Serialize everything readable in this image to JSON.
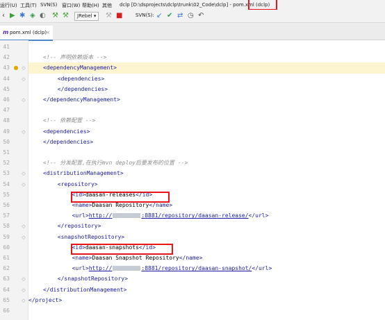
{
  "menubar": {
    "items": [
      "运行(U)",
      "工具(T)",
      "SVN(S)",
      "窗口(W)",
      "帮助(H)",
      "其他"
    ],
    "project_title": "dclp [D:\\dsprojects\\dclp\\trunk\\02_Code\\dclp] - pom.xml (dclp)"
  },
  "toolbar": {
    "jrebel_label": "JRebel ▾",
    "svn_label": "SVN(S):"
  },
  "tab": {
    "label": "pom.xml (dclp)",
    "close": "×"
  },
  "editor": {
    "lines": [
      {
        "number": "41",
        "indent": 0,
        "segments": []
      },
      {
        "number": "42",
        "indent": 2,
        "segments": [
          {
            "cls": "cmt",
            "text": "<!-- 声明依赖版本 -->"
          }
        ]
      },
      {
        "number": "43",
        "indent": 2,
        "highlight": true,
        "segments": [
          {
            "cls": "tag",
            "text": "<dependencyManagement>"
          }
        ]
      },
      {
        "number": "44",
        "indent": 6,
        "segments": [
          {
            "cls": "tag",
            "text": "<dependencies>"
          }
        ]
      },
      {
        "number": "45",
        "indent": 6,
        "segments": [
          {
            "cls": "tag",
            "text": "</dependencies>"
          }
        ]
      },
      {
        "number": "46",
        "indent": 2,
        "segments": [
          {
            "cls": "tag",
            "text": "</dependencyManagement>"
          }
        ]
      },
      {
        "number": "47",
        "indent": 0,
        "segments": []
      },
      {
        "number": "48",
        "indent": 2,
        "segments": [
          {
            "cls": "cmt",
            "text": "<!-- 依赖配置 -->"
          }
        ]
      },
      {
        "number": "49",
        "indent": 2,
        "segments": [
          {
            "cls": "tag",
            "text": "<dependencies>"
          }
        ]
      },
      {
        "number": "50",
        "indent": 2,
        "segments": [
          {
            "cls": "tag",
            "text": "</dependencies>"
          }
        ]
      },
      {
        "number": "51",
        "indent": 0,
        "segments": []
      },
      {
        "number": "52",
        "indent": 2,
        "segments": [
          {
            "cls": "cmt",
            "text": "<!-- 分发配置,在执行mvn deploy后要发布的位置 -->"
          }
        ]
      },
      {
        "number": "53",
        "indent": 2,
        "segments": [
          {
            "cls": "tag",
            "text": "<distributionManagement>"
          }
        ]
      },
      {
        "number": "54",
        "indent": 6,
        "segments": [
          {
            "cls": "tag",
            "text": "<repository>"
          }
        ]
      },
      {
        "number": "55",
        "indent": 10,
        "segments": [
          {
            "cls": "tag",
            "text": "<id>"
          },
          {
            "cls": "txt",
            "text": "daasan-releases"
          },
          {
            "cls": "tag",
            "text": "</id>"
          }
        ]
      },
      {
        "number": "56",
        "indent": 10,
        "segments": [
          {
            "cls": "tag",
            "text": "<name>"
          },
          {
            "cls": "txt",
            "text": "Daasan Repository"
          },
          {
            "cls": "tag",
            "text": "</name>"
          }
        ]
      },
      {
        "number": "57",
        "indent": 10,
        "segments": [
          {
            "cls": "tag",
            "text": "<url>"
          },
          {
            "cls": "url",
            "text": "http://"
          },
          {
            "cls": "blur"
          },
          {
            "cls": "url",
            "text": ":8881/repository/daasan-release/"
          },
          {
            "cls": "tag",
            "text": "</url>"
          }
        ]
      },
      {
        "number": "58",
        "indent": 6,
        "segments": [
          {
            "cls": "tag",
            "text": "</repository>"
          }
        ]
      },
      {
        "number": "59",
        "indent": 6,
        "segments": [
          {
            "cls": "tag",
            "text": "<snapshotRepository>"
          }
        ]
      },
      {
        "number": "60",
        "indent": 10,
        "segments": [
          {
            "cls": "tag",
            "text": "<id>"
          },
          {
            "cls": "txt",
            "text": "daasan-snapshots"
          },
          {
            "cls": "tag",
            "text": "</id>"
          }
        ]
      },
      {
        "number": "61",
        "indent": 10,
        "segments": [
          {
            "cls": "tag",
            "text": "<name>"
          },
          {
            "cls": "txt",
            "text": "Daasan Snapshot Repository"
          },
          {
            "cls": "tag",
            "text": "</name>"
          }
        ]
      },
      {
        "number": "62",
        "indent": 10,
        "segments": [
          {
            "cls": "tag",
            "text": "<url>"
          },
          {
            "cls": "url",
            "text": "http://"
          },
          {
            "cls": "blur"
          },
          {
            "cls": "url",
            "text": ":8881/repository/daasan-snapshot/"
          },
          {
            "cls": "tag",
            "text": "</url>"
          }
        ]
      },
      {
        "number": "63",
        "indent": 6,
        "segments": [
          {
            "cls": "tag",
            "text": "</snapshotRepository>"
          }
        ]
      },
      {
        "number": "64",
        "indent": 2,
        "segments": [
          {
            "cls": "tag",
            "text": "</distributionManagement>"
          }
        ]
      },
      {
        "number": "65",
        "indent": 0,
        "segments": [
          {
            "cls": "tag",
            "text": "</project>"
          }
        ]
      },
      {
        "number": "66",
        "indent": 0,
        "segments": []
      }
    ]
  },
  "colors": {
    "annotation_box": "#e8141a",
    "tag": "#1a1aa6",
    "comment": "#8c8c8c",
    "current_line": "#fcf5cf"
  },
  "icons": [
    "run-icon",
    "debug-icon",
    "coverage-icon",
    "profile-icon",
    "build-icon",
    "stop-icon",
    "svn-update-icon",
    "svn-commit-icon",
    "svn-compare-icon",
    "history-icon",
    "revert-icon",
    "intention-bulb-icon"
  ]
}
